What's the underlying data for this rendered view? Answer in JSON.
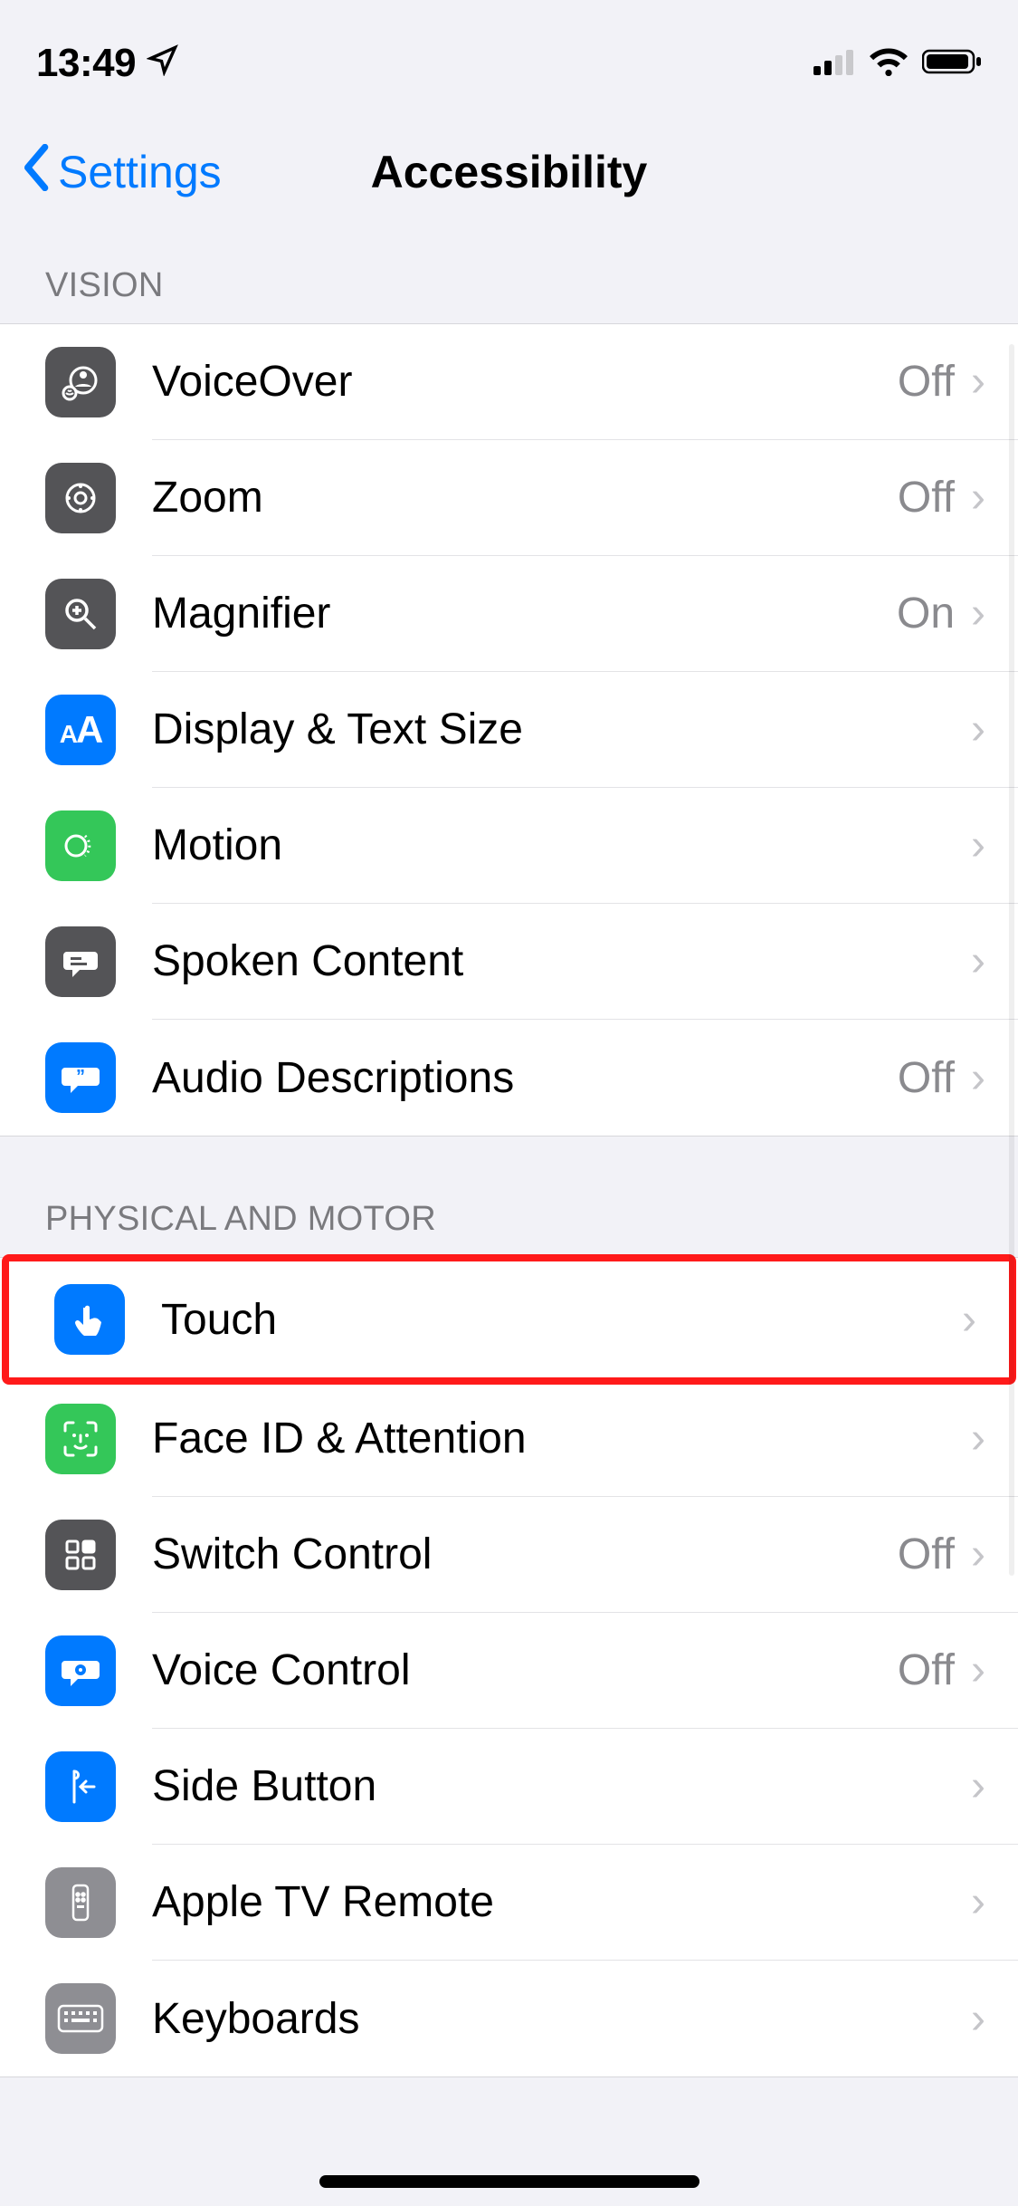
{
  "status": {
    "time": "13:49"
  },
  "nav": {
    "back_label": "Settings",
    "title": "Accessibility"
  },
  "sections": {
    "vision": {
      "header": "VISION",
      "items": [
        {
          "label": "VoiceOver",
          "status": "Off",
          "icon": "voiceover-icon",
          "color": "dark"
        },
        {
          "label": "Zoom",
          "status": "Off",
          "icon": "zoom-icon",
          "color": "dark"
        },
        {
          "label": "Magnifier",
          "status": "On",
          "icon": "magnifier-icon",
          "color": "dark"
        },
        {
          "label": "Display & Text Size",
          "status": "",
          "icon": "text-size-icon",
          "color": "blue"
        },
        {
          "label": "Motion",
          "status": "",
          "icon": "motion-icon",
          "color": "green"
        },
        {
          "label": "Spoken Content",
          "status": "",
          "icon": "spoken-content-icon",
          "color": "dark"
        },
        {
          "label": "Audio Descriptions",
          "status": "Off",
          "icon": "audio-desc-icon",
          "color": "blue"
        }
      ]
    },
    "physical": {
      "header": "PHYSICAL AND MOTOR",
      "items": [
        {
          "label": "Touch",
          "status": "",
          "icon": "touch-icon",
          "color": "blue",
          "highlighted": true
        },
        {
          "label": "Face ID & Attention",
          "status": "",
          "icon": "faceid-icon",
          "color": "green"
        },
        {
          "label": "Switch Control",
          "status": "Off",
          "icon": "switch-control-icon",
          "color": "dark"
        },
        {
          "label": "Voice Control",
          "status": "Off",
          "icon": "voice-control-icon",
          "color": "blue"
        },
        {
          "label": "Side Button",
          "status": "",
          "icon": "side-button-icon",
          "color": "blue"
        },
        {
          "label": "Apple TV Remote",
          "status": "",
          "icon": "apple-tv-remote-icon",
          "color": "gray"
        },
        {
          "label": "Keyboards",
          "status": "",
          "icon": "keyboard-icon",
          "color": "gray"
        }
      ]
    }
  }
}
